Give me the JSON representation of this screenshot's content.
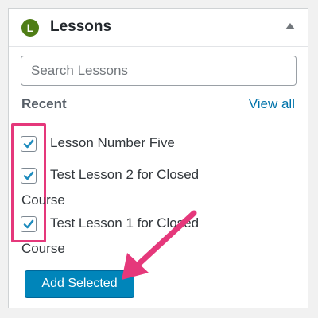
{
  "widget": {
    "logo_letter": "L",
    "title": "Lessons"
  },
  "search": {
    "placeholder": "Search Lessons",
    "value": ""
  },
  "recent": {
    "heading": "Recent",
    "view_all_label": "View all"
  },
  "lessons": [
    {
      "title": "Lesson Number Five",
      "checked": true
    },
    {
      "title": "Test Lesson 2 for Closed Course",
      "checked": true
    },
    {
      "title": "Test Lesson 1 for Closed Course",
      "checked": true
    }
  ],
  "actions": {
    "add_selected_label": "Add Selected"
  },
  "colors": {
    "accent": "#0085ba",
    "link": "#0073aa",
    "highlight": "#e5387b",
    "logo": "#4f7d16"
  }
}
